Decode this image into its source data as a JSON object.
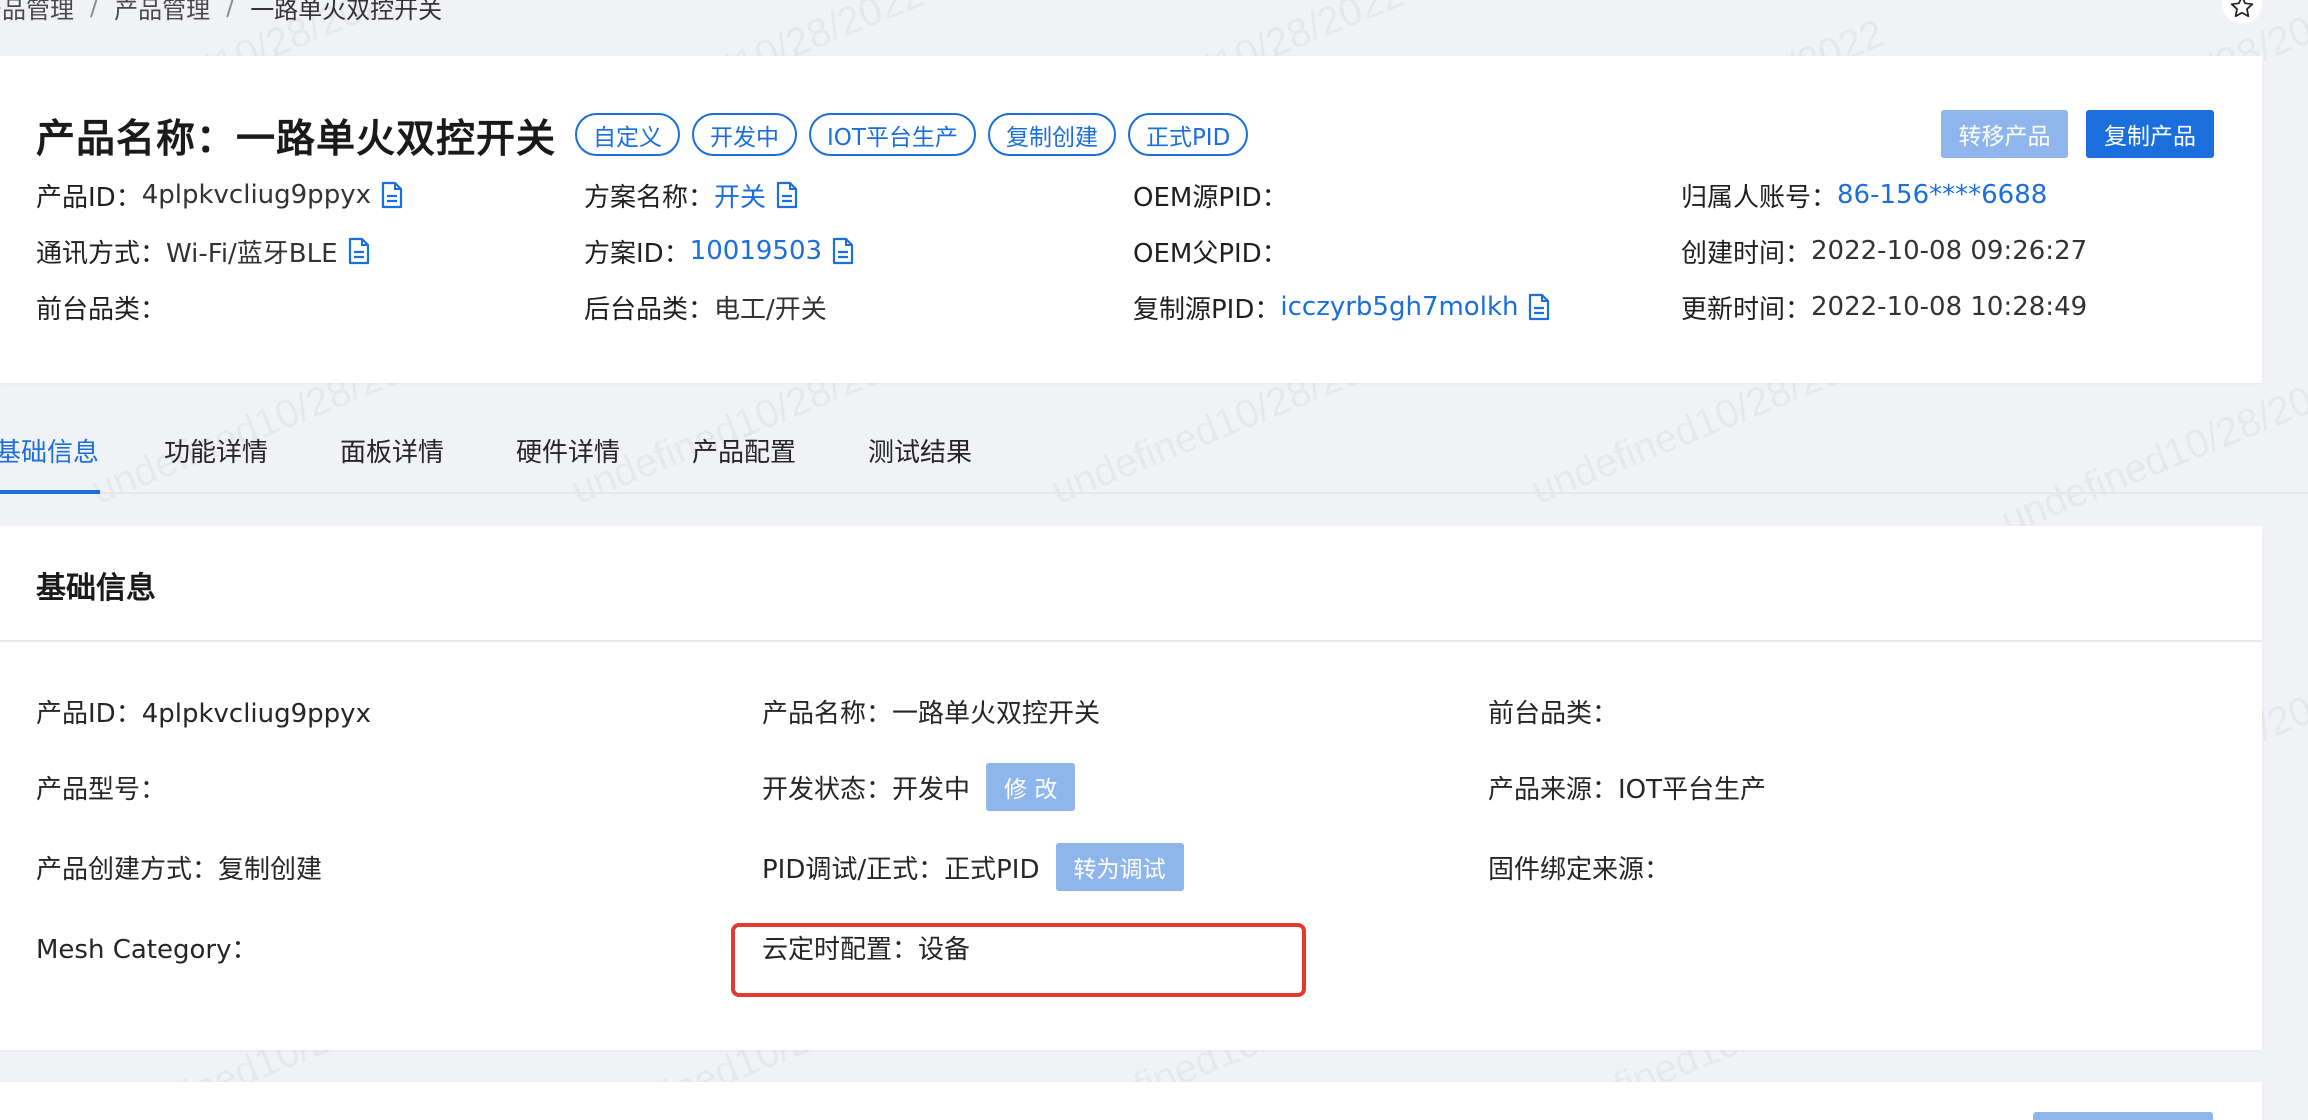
{
  "breadcrumb": {
    "items": [
      "产品管理",
      "产品管理",
      "一路单火双控开关"
    ],
    "separator": "/"
  },
  "header": {
    "title": "产品名称：一路单火双控开关",
    "tags": [
      "自定义",
      "开发中",
      "IOT平台生产",
      "复制创建",
      "正式PID"
    ],
    "transfer_label": "转移产品",
    "copy_label": "复制产品",
    "info": {
      "product_id_label": "产品ID：",
      "product_id": "4plpkvcliug9ppyx",
      "scheme_name_label": "方案名称：",
      "scheme_name": "开关",
      "oem_source_pid_label": "OEM源PID：",
      "owner_account_label": "归属人账号：",
      "owner_account": "86-156****6688",
      "comm_label": "通讯方式：",
      "comm": "Wi-Fi/蓝牙BLE",
      "scheme_id_label": "方案ID：",
      "scheme_id": "10019503",
      "oem_parent_pid_label": "OEM父PID：",
      "create_time_label": "创建时间：",
      "create_time": "2022-10-08 09:26:27",
      "front_category_label": "前台品类：",
      "back_category_label": "后台品类：",
      "back_category": "电工/开关",
      "copy_source_pid_label": "复制源PID：",
      "copy_source_pid": "icczyrb5gh7molkh",
      "update_time_label": "更新时间：",
      "update_time": "2022-10-08 10:28:49"
    }
  },
  "tabs": [
    "基础信息",
    "功能详情",
    "面板详情",
    "硬件详情",
    "产品配置",
    "测试结果"
  ],
  "basic": {
    "title": "基础信息",
    "product_id": "产品ID：4plpkvcliug9ppyx",
    "product_name": "产品名称：一路单火双控开关",
    "front_category": "前台品类：",
    "model": "产品型号：",
    "dev_status": "开发状态：开发中",
    "modify_label": "修 改",
    "source": "产品来源：IOT平台生产",
    "create_method": "产品创建方式：复制创建",
    "pid_mode": "PID调试/正式：正式PID",
    "to_debug_label": "转为调试",
    "firmware_source": "固件绑定来源：",
    "mesh_category": "Mesh Category：",
    "cloud_timer": "云定时配置：设备"
  },
  "watermark_text": "undefined10/28/2022",
  "colors": {
    "accent": "#1a6fdc",
    "accent_light": "#8fb6ec",
    "highlight": "#e03b2c",
    "background": "#f0f2f5"
  },
  "icons": {
    "star": "star-icon",
    "doc": "document-copy-icon"
  }
}
